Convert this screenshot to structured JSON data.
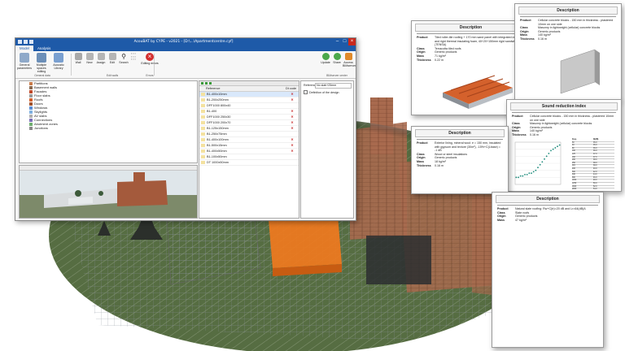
{
  "app": {
    "title": "AcouBAT by CYPE - v2021 - [D:\\...\\Apartmentcentre.cyf]",
    "tabs": [
      "Model",
      "Analysis"
    ],
    "ribbon_groups": [
      {
        "label": "General data",
        "buttons": [
          "General parameters",
          "Multiple spaces editing",
          "Acoustic Library"
        ]
      },
      {
        "label": "Edit walls",
        "buttons": [
          "Wall",
          "New",
          "Assign",
          "Edit",
          "Search"
        ]
      },
      {
        "label": "Errors",
        "buttons": [
          "Editing errors"
        ]
      },
      {
        "label": "BIMserver center",
        "buttons": [
          "Update",
          "Share",
          "Access BIMserver"
        ]
      }
    ],
    "tree_items": [
      "Partitions",
      "Basement walls",
      "Facades",
      "Floor slabs",
      "Roofs",
      "Doors",
      "Windows",
      "Skylights",
      "AV slabs",
      "Connections",
      "Abutment zones",
      "Junctions"
    ],
    "references": {
      "header": [
        "Reference",
        "Dt code"
      ],
      "rows": [
        {
          "name": "B1-400x10mm",
          "status": "✕"
        },
        {
          "name": "B1-200x250mm",
          "status": "✕"
        },
        {
          "name": "DFF1000 800x40",
          "status": ""
        },
        {
          "name": "B1-400",
          "status": "✕"
        },
        {
          "name": "DFF1000 250x30",
          "status": "✕"
        },
        {
          "name": "DFF1000 200x70",
          "status": "✕"
        },
        {
          "name": "B1-125x150mm",
          "status": "✕"
        },
        {
          "name": "B1-250x75mm",
          "status": ""
        },
        {
          "name": "B1-400x100mm",
          "status": "✕"
        },
        {
          "name": "B1-500x15mm",
          "status": "✕"
        },
        {
          "name": "B1-400x50mm",
          "status": "✕"
        },
        {
          "name": "B1-100x50mm",
          "status": ""
        },
        {
          "name": "DT 1000x50mm",
          "status": ""
        }
      ]
    },
    "properties": {
      "label": "Reference",
      "value": "No slab+25mm",
      "checkbox": "Definition of the design"
    }
  },
  "sheets": {
    "roof": {
      "title": "Description",
      "rows": [
        {
          "k": "Product",
          "v": "Tiled roller-tile roofing + 170 mm sand panel with integrated rafters and rigid thermal insulating foam, 40+20+150mm rigid sandwich (TENSA)"
        },
        {
          "k": "Class",
          "v": "Terracotta tiled roofs"
        },
        {
          "k": "Origin",
          "v": "Generic products"
        },
        {
          "k": "Mass",
          "v": "71 kg/m²"
        },
        {
          "k": "Thickness",
          "v": "0.22 m"
        }
      ]
    },
    "block": {
      "title": "Description",
      "rows": [
        {
          "k": "Product",
          "v": "Cellular concrete blocks - 150 mm in thickness - plastered 10mm on one side"
        },
        {
          "k": "Class",
          "v": "Masonry in lightweight (cellular) concrete blocks"
        },
        {
          "k": "Origin",
          "v": "Generic products"
        },
        {
          "k": "Mass",
          "v": "140 kg/m²"
        },
        {
          "k": "Thickness",
          "v": "0.16 m"
        }
      ]
    },
    "sound": {
      "title": "Sound reduction index",
      "rows": [
        {
          "k": "Product",
          "v": "Cellular concrete blocks - 150 mm in thickness - plastered 10mm on one side"
        },
        {
          "k": "Class",
          "v": "Masonry in lightweight (cellular) concrete blocks"
        },
        {
          "k": "Origin",
          "v": "Generic products"
        },
        {
          "k": "Mass",
          "v": "140 kg/m²"
        },
        {
          "k": "Thickness",
          "v": "0.16 m"
        }
      ],
      "table_head": [
        "Freq.",
        "R(dB)"
      ],
      "freqs": [
        "50",
        "63",
        "80",
        "100",
        "125",
        "160",
        "200",
        "250",
        "315",
        "400",
        "500",
        "630",
        "800",
        "1000",
        "1250",
        "1600",
        "2000",
        "2500",
        "3150",
        "4000",
        "5000"
      ],
      "r_values": [
        35.0,
        35.0,
        36.0,
        36.0,
        37.0,
        37.0,
        38.0,
        38.0,
        39.0,
        40.0,
        42.0,
        44.0,
        46.0,
        48.0,
        50.0,
        52.0,
        54.0,
        55.0,
        56.0,
        57.0,
        58.0
      ]
    },
    "facade": {
      "title": "Description",
      "rows": [
        {
          "k": "Product",
          "v": "Exterior lining, mineral wool: e = 150 mm, insulated with gypsum and texture (30m²), -15%+C(Lbase) = -1 dB"
        },
        {
          "k": "Class",
          "v": "Wood or steel insulations"
        },
        {
          "k": "Origin",
          "v": "Generic products"
        },
        {
          "k": "Mass",
          "v": "18 kg/m²"
        },
        {
          "k": "Thickness",
          "v": "0.16 m"
        }
      ]
    },
    "roof2": {
      "title": "Description",
      "rows": [
        {
          "k": "Product",
          "v": "Natural slate roofing: Rw+C(tr)=20 dB and Lr=64(dB)A"
        },
        {
          "k": "Class",
          "v": "Slate roofs"
        },
        {
          "k": "Origin",
          "v": "Generic products"
        },
        {
          "k": "Mass",
          "v": "47 kg/m²"
        }
      ]
    }
  },
  "colors": {
    "accent": "#1e5aa8",
    "orange": "#f07a1e",
    "brick": "#b5563a"
  }
}
